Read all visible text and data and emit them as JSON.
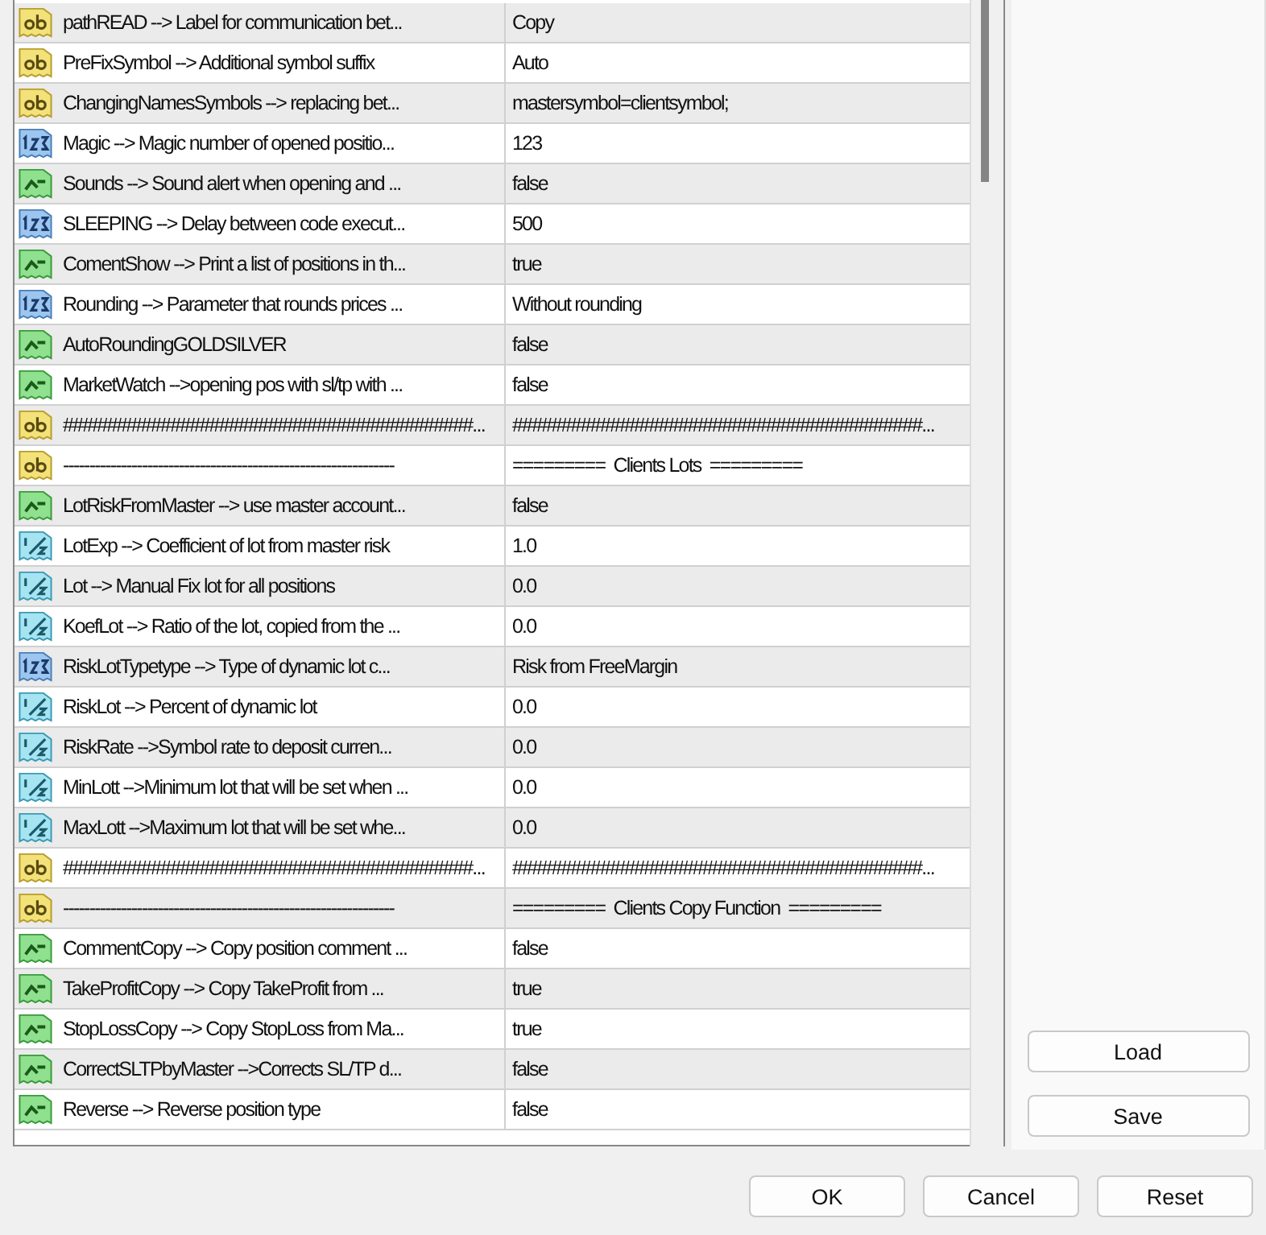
{
  "parameters": [
    {
      "kind": "string",
      "name": "pathREAD --> Label for communication bet...",
      "value": "Copy"
    },
    {
      "kind": "string",
      "name": "PreFixSymbol --> Additional symbol suffix",
      "value": "Auto"
    },
    {
      "kind": "string",
      "name": "ChangingNamesSymbols --> replacing bet...",
      "value": "mastersymbol=clientsymbol;"
    },
    {
      "kind": "int",
      "name": "Magic --> Magic number of opened positio...",
      "value": "123"
    },
    {
      "kind": "bool",
      "name": "Sounds --> Sound alert when opening and ...",
      "value": "false"
    },
    {
      "kind": "int",
      "name": "SLEEPING --> Delay between code execut...",
      "value": "500"
    },
    {
      "kind": "bool",
      "name": "ComentShow --> Print a list of positions in th...",
      "value": "true"
    },
    {
      "kind": "int",
      "name": "Rounding --> Parameter that rounds prices ...",
      "value": "Without rounding"
    },
    {
      "kind": "bool",
      "name": "AutoRoundingGOLDSILVER",
      "value": "false"
    },
    {
      "kind": "bool",
      "name": "MarketWatch -->opening pos with sl/tp with ...",
      "value": "false"
    },
    {
      "kind": "string",
      "name": "##########################################...",
      "value": "##########################################..."
    },
    {
      "kind": "string",
      "name": "---------------------------------------------------------------",
      "value": "=========  Clients Lots  ========="
    },
    {
      "kind": "bool",
      "name": "LotRiskFromMaster --> use master account...",
      "value": "false"
    },
    {
      "kind": "double",
      "name": "LotExp --> Coefficient of lot from master risk",
      "value": "1.0"
    },
    {
      "kind": "double",
      "name": "Lot --> Manual Fix lot for all positions",
      "value": "0.0"
    },
    {
      "kind": "double",
      "name": "KoefLot --> Ratio of the lot, copied from the ...",
      "value": "0.0"
    },
    {
      "kind": "int",
      "name": "RiskLotTypetype --> Type of dynamic lot c...",
      "value": "Risk from FreeMargin"
    },
    {
      "kind": "double",
      "name": "RiskLot --> Percent of dynamic lot",
      "value": "0.0"
    },
    {
      "kind": "double",
      "name": "RiskRate -->Symbol rate to deposit curren...",
      "value": "0.0"
    },
    {
      "kind": "double",
      "name": "MinLott -->Minimum lot that will be set when ...",
      "value": "0.0"
    },
    {
      "kind": "double",
      "name": "MaxLott -->Maximum lot that will be set whe...",
      "value": "0.0"
    },
    {
      "kind": "string",
      "name": "##########################################...",
      "value": "##########################################..."
    },
    {
      "kind": "string",
      "name": "---------------------------------------------------------------",
      "value": "=========  Clients Copy Function  ========="
    },
    {
      "kind": "bool",
      "name": "CommentCopy --> Copy position comment ...",
      "value": "false"
    },
    {
      "kind": "bool",
      "name": "TakeProfitCopy --> Copy TakeProfit from ...",
      "value": "true"
    },
    {
      "kind": "bool",
      "name": "StopLossCopy --> Copy StopLoss from Ma...",
      "value": "true"
    },
    {
      "kind": "bool",
      "name": "CorrectSLTPbyMaster -->Corrects SL/TP d...",
      "value": "false"
    },
    {
      "kind": "bool",
      "name": "Reverse --> Reverse position type",
      "value": "false"
    }
  ],
  "side_buttons": [
    "Load",
    "Save"
  ],
  "buttons": [
    "OK",
    "Cancel",
    "Reset"
  ]
}
